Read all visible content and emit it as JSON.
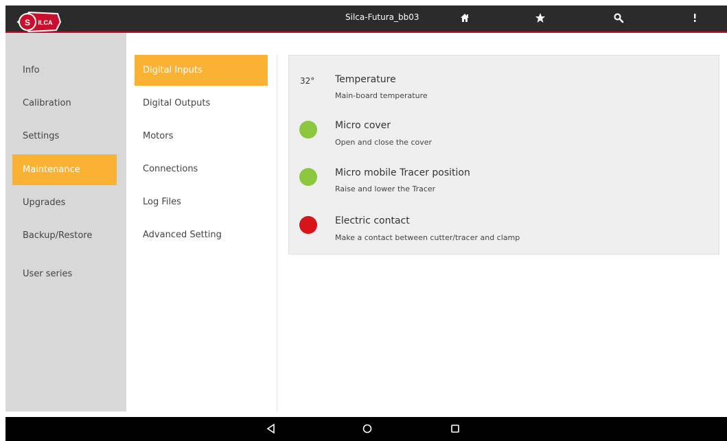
{
  "app": {
    "title": "Silca-Futura_bb03",
    "logo_text": "SILCA"
  },
  "toolbar": {
    "icons": [
      "home-icon",
      "star-icon",
      "search-icon",
      "more-vert-icon"
    ]
  },
  "sidebar": {
    "items": [
      {
        "label": "Info"
      },
      {
        "label": "Calibration"
      },
      {
        "label": "Settings"
      },
      {
        "label": "Maintenance",
        "active": true
      },
      {
        "label": "Upgrades"
      },
      {
        "label": "Backup/Restore"
      },
      {
        "label": "User series"
      }
    ]
  },
  "submenu": {
    "items": [
      {
        "label": "Digital Inputs",
        "active": true
      },
      {
        "label": "Digital Outputs"
      },
      {
        "label": "Motors"
      },
      {
        "label": "Connections"
      },
      {
        "label": "Log Files"
      },
      {
        "label": "Advanced Setting"
      }
    ]
  },
  "inputs": {
    "rows": [
      {
        "value": "32°",
        "title": "Temperature",
        "desc": "Main-board temperature"
      },
      {
        "state": "green",
        "title": "Micro cover",
        "desc": "Open and close the cover"
      },
      {
        "state": "green",
        "title": "Micro mobile Tracer position",
        "desc": "Raise and lower the Tracer"
      },
      {
        "state": "red",
        "title": "Electric contact",
        "desc": "Make a contact between cutter/tracer and clamp"
      }
    ]
  },
  "navbar": {
    "icons": [
      "back-icon",
      "home-circle-icon",
      "recents-icon"
    ]
  },
  "colors": {
    "accent": "#f9b233",
    "status_green": "#8dc63f",
    "status_red": "#d7141a",
    "brand_red": "#c8102e"
  }
}
